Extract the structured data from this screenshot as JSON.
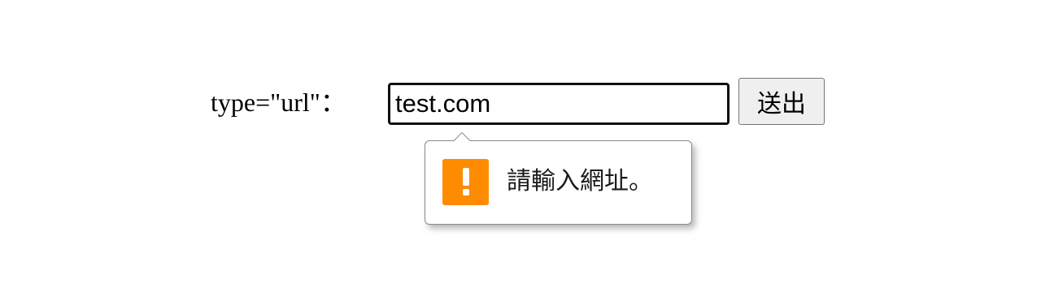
{
  "form": {
    "label": "type=\"url\"：",
    "input_value": "test.com",
    "submit_label": "送出"
  },
  "validation_tooltip": {
    "icon": "warning-icon",
    "message": "請輸入網址。"
  },
  "colors": {
    "warning_icon": "#ff8c00",
    "button_background": "#efefef",
    "input_border": "#101010"
  }
}
